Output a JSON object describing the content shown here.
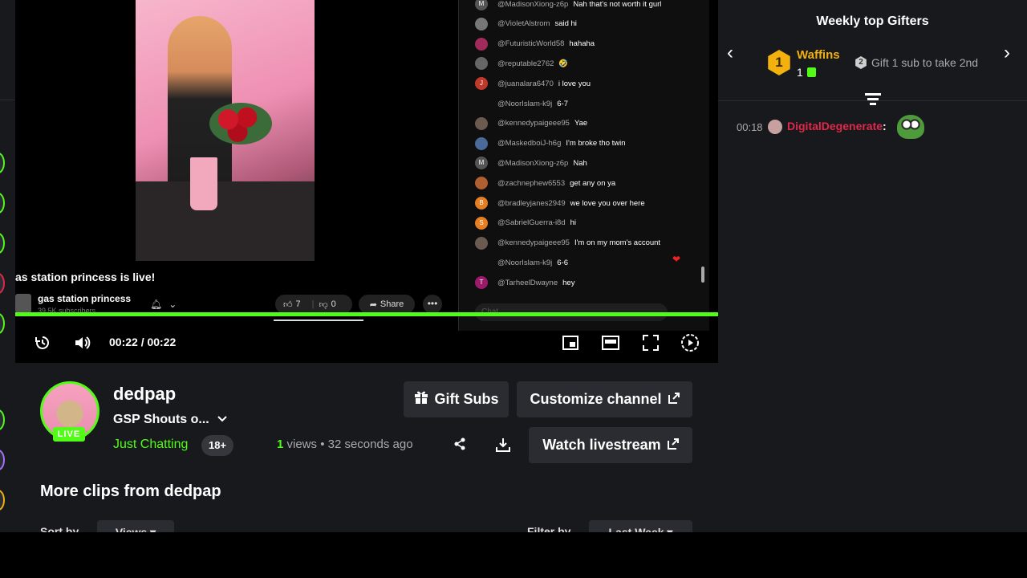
{
  "video": {
    "embedded_title": "as station princess is live!",
    "embedded_channel": "gas station princess",
    "embedded_subs": "39.5K subscribers",
    "embedded_likes": "7",
    "embedded_dislikes": "0",
    "embedded_share": "Share",
    "time_display": "00:22 / 00:22",
    "progress": 1.0
  },
  "embedded_chat": {
    "messages": [
      {
        "user": "@MadisonXiong-z6p",
        "msg": "Nah that's not worth it gurl",
        "avatar": "M",
        "color": "#555"
      },
      {
        "user": "@VioletAlstrom",
        "msg": "said hi",
        "avatar": "",
        "color": "#777"
      },
      {
        "user": "@FuturisticWorld58",
        "msg": "hahaha",
        "avatar": "",
        "color": "#a02a5a"
      },
      {
        "user": "@reputable2762",
        "msg": "🤣",
        "avatar": "",
        "color": "#666"
      },
      {
        "user": "@juanalara6470",
        "msg": "i love you",
        "avatar": "J",
        "color": "#c0392b"
      },
      {
        "user": "@NoorIslam-k9j",
        "msg": "6-7",
        "avatar": "",
        "color": "#0f0f0f"
      },
      {
        "user": "@kennedypaigeee95",
        "msg": "Yae",
        "avatar": "",
        "color": "#6a5a50"
      },
      {
        "user": "@MaskedboiJ-h6g",
        "msg": "I'm broke tho twin",
        "avatar": "",
        "color": "#4a6a9a"
      },
      {
        "user": "@MadisonXiong-z6p",
        "msg": "Nah",
        "avatar": "M",
        "color": "#555"
      },
      {
        "user": "@zachnephew6553",
        "msg": "get any on ya",
        "avatar": "",
        "color": "#b06030"
      },
      {
        "user": "@bradleyjanes2949",
        "msg": "we love you over here",
        "avatar": "B",
        "color": "#e67e22"
      },
      {
        "user": "@SabrielGuerra-i8d",
        "msg": "hi",
        "avatar": "S",
        "color": "#e67e22"
      },
      {
        "user": "@kennedypaigeee95",
        "msg": "I'm on my mom's account",
        "avatar": "",
        "color": "#6a5a50"
      },
      {
        "user": "@NoorIslam-k9j",
        "msg": "6-6",
        "avatar": "",
        "color": "#0f0f0f"
      },
      {
        "user": "@TarheelDwayne",
        "msg": "hey",
        "avatar": "T",
        "color": "#9b1b6a"
      }
    ],
    "input_placeholder": "Chat..."
  },
  "gifters": {
    "title": "Weekly top Gifters",
    "top_name": "Waffins",
    "top_rank": "1",
    "top_count": "1",
    "next_rank": "2",
    "hint": "Gift 1 sub to take 2nd"
  },
  "live_chat": {
    "time": "00:18",
    "user": "DigitalDegenerate",
    "separator": ":"
  },
  "channel": {
    "live_label": "LIVE",
    "name": "dedpap",
    "title": "GSP Shouts o...",
    "category": "Just Chatting",
    "age_badge": "18+",
    "views_count": "1",
    "views_label": " views",
    "posted": " • 32 seconds ago"
  },
  "buttons": {
    "gift_subs": "Gift Subs",
    "customize": "Customize channel",
    "watch_live": "Watch livestream"
  },
  "clips": {
    "heading": "More clips from dedpap",
    "sort_label": "Sort by",
    "sort_value": "Views ▾",
    "filter_label": "Filter by",
    "filter_value": "Last Week ▾"
  },
  "colors": {
    "accent": "#53fc18",
    "gold": "#f2b10d",
    "background": "#18191d"
  }
}
